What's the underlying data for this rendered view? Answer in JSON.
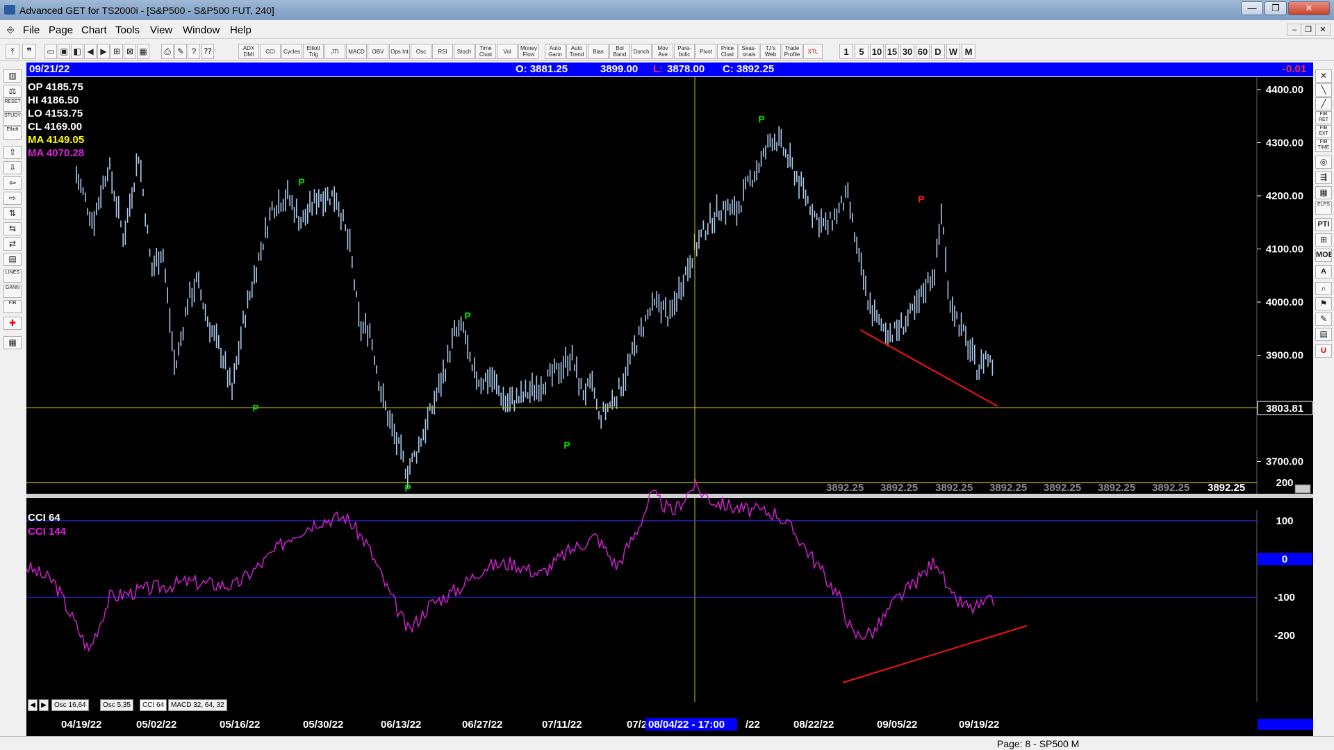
{
  "window": {
    "title": "Advanced GET for TS2000i - [S&P500 - S&P500 FUT, 240]",
    "controls": [
      "—",
      "❐",
      "✕"
    ]
  },
  "menu": {
    "items": [
      "File",
      "Page",
      "Chart",
      "Tools",
      "View",
      "Window",
      "Help"
    ],
    "mdi_controls": [
      "–",
      "❐",
      "✕"
    ]
  },
  "toolbar": {
    "study_buttons": [
      "ADX DMI",
      "CCI",
      "Cycles",
      "Elliott Trig",
      "JTI",
      "MACD",
      "OBV",
      "Ops Int",
      "Osc",
      "RSI",
      "Stoch",
      "Time Clust",
      "Vol",
      "Money Flow",
      "Auto Gann",
      "Auto Trend",
      "Bias",
      "Bol Band",
      "Donch",
      "Mov Ave",
      "Para-bolic",
      "Pivot",
      "Price Clust",
      "Seas-onals",
      "TJ's Web",
      "Trade Profile",
      "XTL"
    ],
    "interval_buttons": [
      "1",
      "5",
      "10",
      "15",
      "30",
      "60",
      "D",
      "W",
      "M"
    ]
  },
  "left_tools": [
    "",
    "",
    "RESET",
    "STUDY",
    "Elliott",
    "",
    "",
    "",
    "",
    "",
    "",
    "",
    "",
    "LINES",
    "GANN",
    "FIB",
    "",
    ""
  ],
  "right_tools": [
    "",
    "",
    "",
    "FIB RET",
    "FIB EXT",
    "FIB TIME",
    "",
    "",
    "",
    "ELPS",
    "PTI",
    "",
    "MOB",
    "A",
    "",
    "",
    "",
    "",
    "U"
  ],
  "info_bar": {
    "date": "09/21/22",
    "open": "O: 3881.25",
    "high": "3899.00",
    "low_label": "L:",
    "low": "3878.00",
    "close": "C: 3892.25",
    "change": "-0.01"
  },
  "overlay": {
    "op": "OP  4185.75",
    "hi": "HI   4186.50",
    "lo": "LO  4153.75",
    "cl": "CL  4169.00",
    "ma1": "MA  4149.05",
    "ma2": "MA  4070.28"
  },
  "price_axis": {
    "ticks": [
      "4400.00",
      "4300.00",
      "4200.00",
      "4100.00",
      "4000.00",
      "3900.00",
      "3700.00"
    ],
    "tick_values": [
      4400,
      4300,
      4200,
      4100,
      4000,
      3900,
      3700
    ],
    "cursor_label": "3803.81",
    "cursor_value": 3803.81
  },
  "bottom_price_labels": [
    "3892.25",
    "3892.25",
    "3892.25",
    "3892.25",
    "3892.25",
    "3892.25",
    "3892.25",
    "3892.25"
  ],
  "indicator": {
    "label1": "CCI 64",
    "label2": "CCI  144",
    "ticks": [
      "200",
      "100",
      "0",
      "-100",
      "-200"
    ],
    "tick_values": [
      200,
      100,
      0,
      -100,
      -200
    ]
  },
  "pivots": [
    {
      "label": "P",
      "type": "low",
      "price": 3815
    },
    {
      "label": "P",
      "type": "high",
      "price": 4212
    },
    {
      "label": "P",
      "type": "low",
      "price": 3665
    },
    {
      "label": "P",
      "type": "high",
      "price": 3960
    },
    {
      "label": "P",
      "type": "low",
      "price": 3745
    },
    {
      "label": "P",
      "type": "high",
      "price": 4330
    },
    {
      "label": "P",
      "type": "high",
      "price": 4180
    }
  ],
  "tabs": [
    "Osc 16,64",
    "Osc 5,35",
    "CCI 64",
    "MACD 32, 64, 32"
  ],
  "dates": [
    "04/19/22",
    "05/02/22",
    "05/16/22",
    "05/30/22",
    "06/13/22",
    "06/27/22",
    "07/11/22",
    "07/2",
    "08/04/22 - 17:00",
    "/22",
    "08/22/22",
    "09/05/22",
    "09/19/22"
  ],
  "status": {
    "page": "Page: 8 - SP500 M"
  },
  "colors": {
    "bars": "#a9c8ec",
    "ma_fast": "#ffff00",
    "ma_slow": "#e020e0",
    "trend": "#ff1010",
    "pivot_green": "#00e000",
    "pivot_red": "#ff2020",
    "info_bar": "#0000ff"
  }
}
